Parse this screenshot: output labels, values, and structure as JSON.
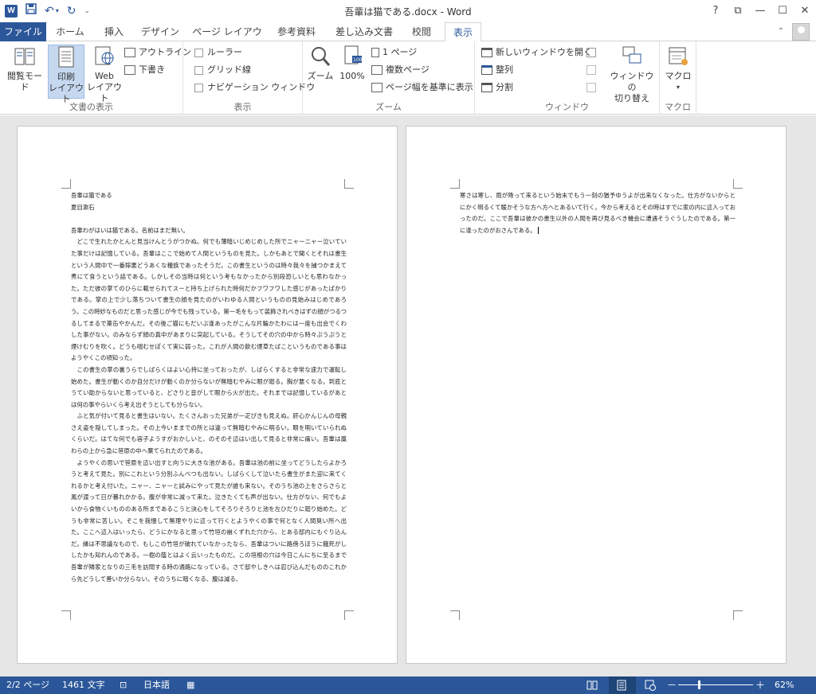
{
  "window": {
    "title": "吾輩は猫である.docx - Word",
    "app_icon_letter": "W",
    "controls": {
      "help": "?",
      "ribbon_display": "⧉",
      "minimize": "—",
      "maximize": "☐",
      "close": "✕"
    }
  },
  "tabs": [
    {
      "label": "ファイル"
    },
    {
      "label": "ホーム"
    },
    {
      "label": "挿入"
    },
    {
      "label": "デザイン"
    },
    {
      "label": "ページ レイアウト"
    },
    {
      "label": "参考資料"
    },
    {
      "label": "差し込み文書"
    },
    {
      "label": "校閲"
    },
    {
      "label": "表示"
    }
  ],
  "ribbon": {
    "views": {
      "group_label": "文書の表示",
      "read_mode": "閲覧モード",
      "print_layout": "印刷\nレイアウト",
      "web_layout": "Web\nレイアウト",
      "outline": "アウトライン",
      "draft": "下書き"
    },
    "show": {
      "group_label": "表示",
      "ruler": "ルーラー",
      "gridlines": "グリッド線",
      "navigation_pane": "ナビゲーション ウィンドウ"
    },
    "zoom": {
      "group_label": "ズーム",
      "zoom": "ズーム",
      "hundred": "100%",
      "one_page": "1 ページ",
      "multiple_pages": "複数ページ",
      "page_width": "ページ幅を基準に表示"
    },
    "window": {
      "group_label": "ウィンドウ",
      "new_window": "新しいウィンドウを開く",
      "arrange_all": "整列",
      "split": "分割",
      "switch_windows": "ウィンドウの\n切り替え"
    },
    "macros": {
      "group_label": "マクロ",
      "macros": "マクロ"
    }
  },
  "document": {
    "page1": {
      "title": "吾輩は猫である",
      "author": "夏目漱石",
      "paragraphs": [
        "吾輩わがはいは猫である。名前はまだ無い。",
        "　どこで生れたかとんと見当けんとうがつかぬ。何でも薄暗いじめじめした所でニャーニャー泣いていた事だけは記憶している。吾輩はここで始めて人間というものを見た。しかもあとで聞くとそれは書生という人間中で一番獰悪どうあくな種族であったそうだ。この書生というのは時々我々を捕つかまえて煮にて食うという話である。しかしその当時は何という考もなかったから別段恐しいとも思わなかった。ただ彼の掌てのひらに載せられてスーと持ち上げられた時何だかフワフワした感じがあったばかりである。掌の上で少し落ちついて書生の顔を見たのがいわゆる人間というものの見始みはじめであろう。この時妙なものだと思った感じが今でも残っている。第一毛をもって装飾されべきはずの顔がつるつるしてまるで薬缶やかんだ。その後ご猫にもだいぶ逢あったがこんな片輪かたわには一度も出会でくわした事がない。のみならず顔の真中があまりに突起している。そうしてその穴の中から時々ぷうぷうと煙けむりを吹く。どうも咽むせぽくて実に弱った。これが人間の飲む煙草たばこというものである事はようやくこの頃知った。",
        "　この書生の掌の裏うらでしばらくはよい心持に坐っておったが、しばらくすると非常な速力で運転し始めた。書生が動くのか自分だけが動くのか分らないが無暗むやみに眼が廻る。胸が悪くなる。到底とうてい助からないと思っていると、どさりと音がして眼から火が出た。それまでは記憶しているがあとは何の事やらいくら考え出そうとしても分らない。",
        "　ふと気が付いて見ると書生はいない。たくさんおった兄弟が一疋ぴきも見えぬ。肝心かんじんの母親さえ姿を隠してしまった。その上今いままでの所とは違って無暗むやみに明るい。眼を明いていられぬくらいだ。はてな何でも容子ようすがおかしいと、のそのそ這はい出して見ると非常に痛い。吾輩は藁わらの上から急に笹原の中へ棄てられたのである。",
        "　ようやくの思いで笹原を這い出すと向うに大きな池がある。吾輩は池の前に坐ってどうしたらよかろうと考えて見た。別にこれという分別ふんべつも出ない。しばらくして泣いたら書生がまた迎に来てくれるかと考え付いた。ニャー、ニャーと試みにやって見たが誰も来ない。そのうち池の上をさらさらと風が渡って日が暮れかかる。腹が非常に減って来た。泣きたくても声が出ない。仕方がない、何でもよいから食物くいもののある所まであるこうと決心をしてそろりそろりと池を左ひだりに廻り始めた。どうも非常に苦しい。そこを我慢して無理やりに這って行くとようやくの事で何となく人間臭い所へ出た。ここへ這入はいったら、どうにかなると思って竹垣の崩くずれた穴から、とある邸内にもぐり込んだ。縁は不思議なもので、もしこの竹垣が破れていなかったなら、吾輩はついに路傍ろぼうに餓死がししたかも知れんのである。一樹の蔭とはよく云いったものだ。この垣根の穴は今日こんにちに至るまで吾輩が隣家となりの三毛を訪問する時の通路になっている。さて邸やしきへは忍び込んだもののこれから先どうして善いか分らない。そのうちに暗くなる、腹は減る、"
      ]
    },
    "page2": {
      "paragraphs": [
        "寒さは寒し、雨が降って来るという始末でもう一刻の猶予ゆうよが出来なくなった。仕方がないからとにかく明るくて暖かそうな方へ方へとあるいて行く。今から考えるとその時はすでに家の内に這入っておったのだ。ここで吾輩は彼かの書生以外の人間を再び見るべき機会に遭遇そうぐうしたのである。第一に逢ったのがおさんである。"
      ]
    }
  },
  "statusbar": {
    "page": "2/2 ページ",
    "words": "1461 文字",
    "language": "日本語",
    "zoom_percent": "62%",
    "zoom_minus": "－",
    "zoom_plus": "＋"
  }
}
